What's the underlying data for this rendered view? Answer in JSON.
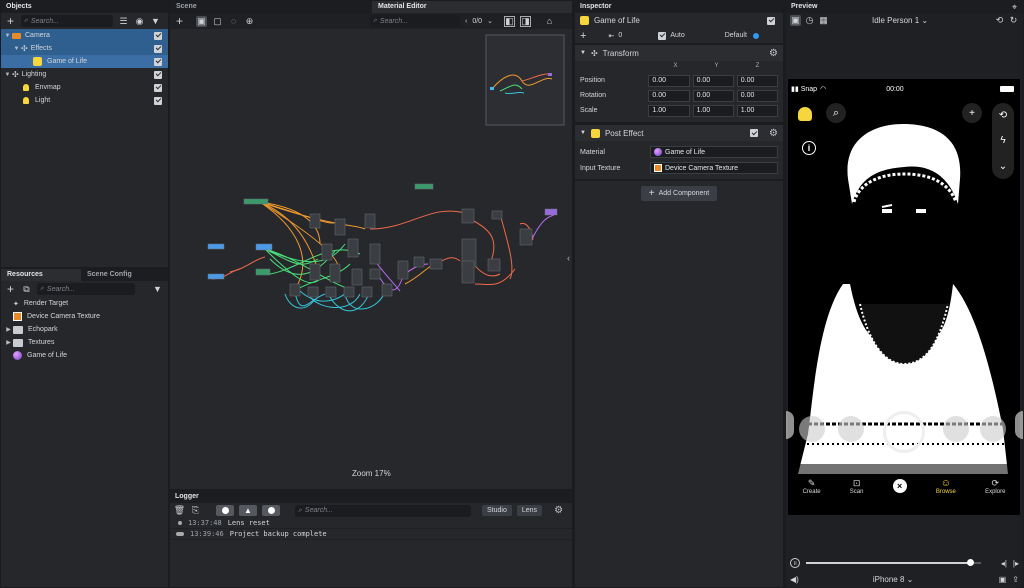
{
  "objects": {
    "title": "Objects",
    "search_placeholder": "Search...",
    "items": [
      {
        "label": "Camera",
        "icon": "camera-icon"
      },
      {
        "label": "Effects",
        "icon": "effects-icon"
      },
      {
        "label": "Game of Life",
        "icon": "post-effect-icon"
      },
      {
        "label": "Lighting",
        "icon": "lighting-icon"
      },
      {
        "label": "Envmap",
        "icon": "bulb-icon"
      },
      {
        "label": "Light",
        "icon": "bulb-icon"
      }
    ]
  },
  "resources": {
    "tabs": [
      "Resources",
      "Scene Config"
    ],
    "search_placeholder": "Search...",
    "items": [
      {
        "label": "Render Target"
      },
      {
        "label": "Device Camera Texture"
      },
      {
        "label": "Echopark"
      },
      {
        "label": "Textures"
      },
      {
        "label": "Game of Life"
      }
    ]
  },
  "scene": {
    "tabs": [
      "Scene",
      "Material Editor"
    ],
    "search_placeholder": "Search...",
    "counter": "0/0",
    "zoom_label": "Zoom 17%"
  },
  "logger": {
    "title": "Logger",
    "search_placeholder": "Search...",
    "studio_label": "Studio",
    "lens_label": "Lens",
    "entries": [
      {
        "time": "13:37:48",
        "text": "Lens reset"
      },
      {
        "time": "13:39:46",
        "text": "Project backup complete"
      }
    ]
  },
  "inspector": {
    "title": "Inspector",
    "object_name": "Game of Life",
    "layer_value": "0",
    "auto_label": "Auto",
    "default_label": "Default",
    "transform": {
      "title": "Transform",
      "axes": [
        "X",
        "Y",
        "Z"
      ],
      "rows": [
        {
          "label": "Position",
          "values": [
            "0.00",
            "0.00",
            "0.00"
          ]
        },
        {
          "label": "Rotation",
          "values": [
            "0.00",
            "0.00",
            "0.00"
          ]
        },
        {
          "label": "Scale",
          "values": [
            "1.00",
            "1.00",
            "1.00"
          ]
        }
      ]
    },
    "post_effect": {
      "title": "Post Effect",
      "material_label": "Material",
      "material_value": "Game of Life",
      "input_label": "Input Texture",
      "input_value": "Device Camera Texture"
    },
    "add_component": "Add Component"
  },
  "preview": {
    "title": "Preview",
    "person_select": "Idle Person 1",
    "carrier": "Snap",
    "clock": "00:00",
    "bottom_tabs": [
      "Create",
      "Scan",
      "",
      "Browse",
      "Explore"
    ],
    "device_select": "iPhone 8",
    "playback_progress": 0.94,
    "accent": "#f5d63d"
  }
}
